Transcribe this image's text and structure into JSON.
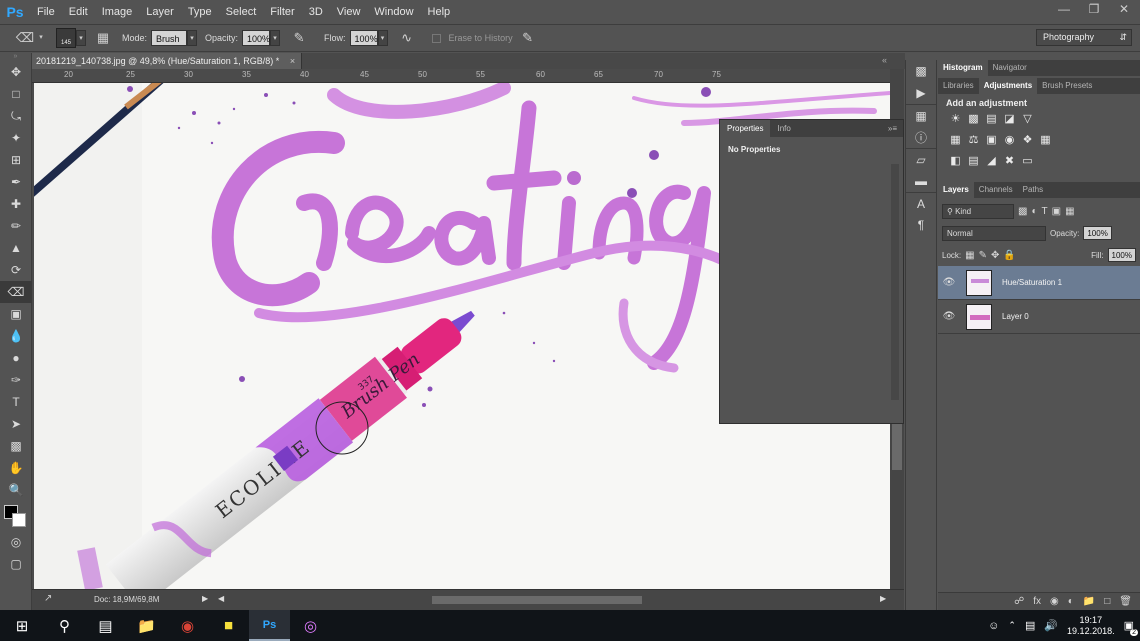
{
  "app": {
    "logo": "Ps"
  },
  "menu": [
    "File",
    "Edit",
    "Image",
    "Layer",
    "Type",
    "Select",
    "Filter",
    "3D",
    "View",
    "Window",
    "Help"
  ],
  "options_bar": {
    "brush_size": "145",
    "mode_label": "Mode:",
    "mode_value": "Brush",
    "opacity_label": "Opacity:",
    "opacity_value": "100%",
    "flow_label": "Flow:",
    "flow_value": "100%",
    "erase_history_label": "Erase to History",
    "workspace": "Photography"
  },
  "document": {
    "tab_title": "20181219_140738.jpg @ 49,8% (Hue/Saturation 1, RGB/8) *",
    "doc_info": "Doc: 18,9M/69,8M",
    "ruler_ticks": [
      "20",
      "25",
      "30",
      "35",
      "40",
      "45",
      "50",
      "55",
      "60",
      "65",
      "70",
      "75"
    ],
    "artwork_text": "Creating",
    "pen_brand": "ECOLINE",
    "pen_label": "Brush Pen",
    "pen_number": "337"
  },
  "properties_panel": {
    "tabs": [
      "Properties",
      "Info"
    ],
    "body": "No Properties"
  },
  "top_panel": {
    "tabs_row1": [
      "Histogram",
      "Navigator"
    ],
    "tabs_row2": [
      "Libraries",
      "Adjustments",
      "Brush Presets"
    ],
    "adjustments_title": "Add an adjustment"
  },
  "layers_panel": {
    "tabs": [
      "Layers",
      "Channels",
      "Paths"
    ],
    "kind_label": "Kind",
    "blend_mode": "Normal",
    "opacity_label": "Opacity:",
    "opacity_value": "100%",
    "lock_label": "Lock:",
    "fill_label": "Fill:",
    "fill_value": "100%",
    "layers": [
      {
        "name": "Hue/Saturation 1",
        "selected": true
      },
      {
        "name": "Layer 0",
        "selected": false
      }
    ]
  },
  "taskbar": {
    "time": "19:17",
    "date": "19.12.2018.",
    "notification_count": "2"
  },
  "colors": {
    "ui_bg": "#535353",
    "selected_layer": "#6b7c93",
    "artwork_purple": "#c36bd6",
    "pen_pink": "#e2267e",
    "ps_blue": "#31a8ff"
  }
}
